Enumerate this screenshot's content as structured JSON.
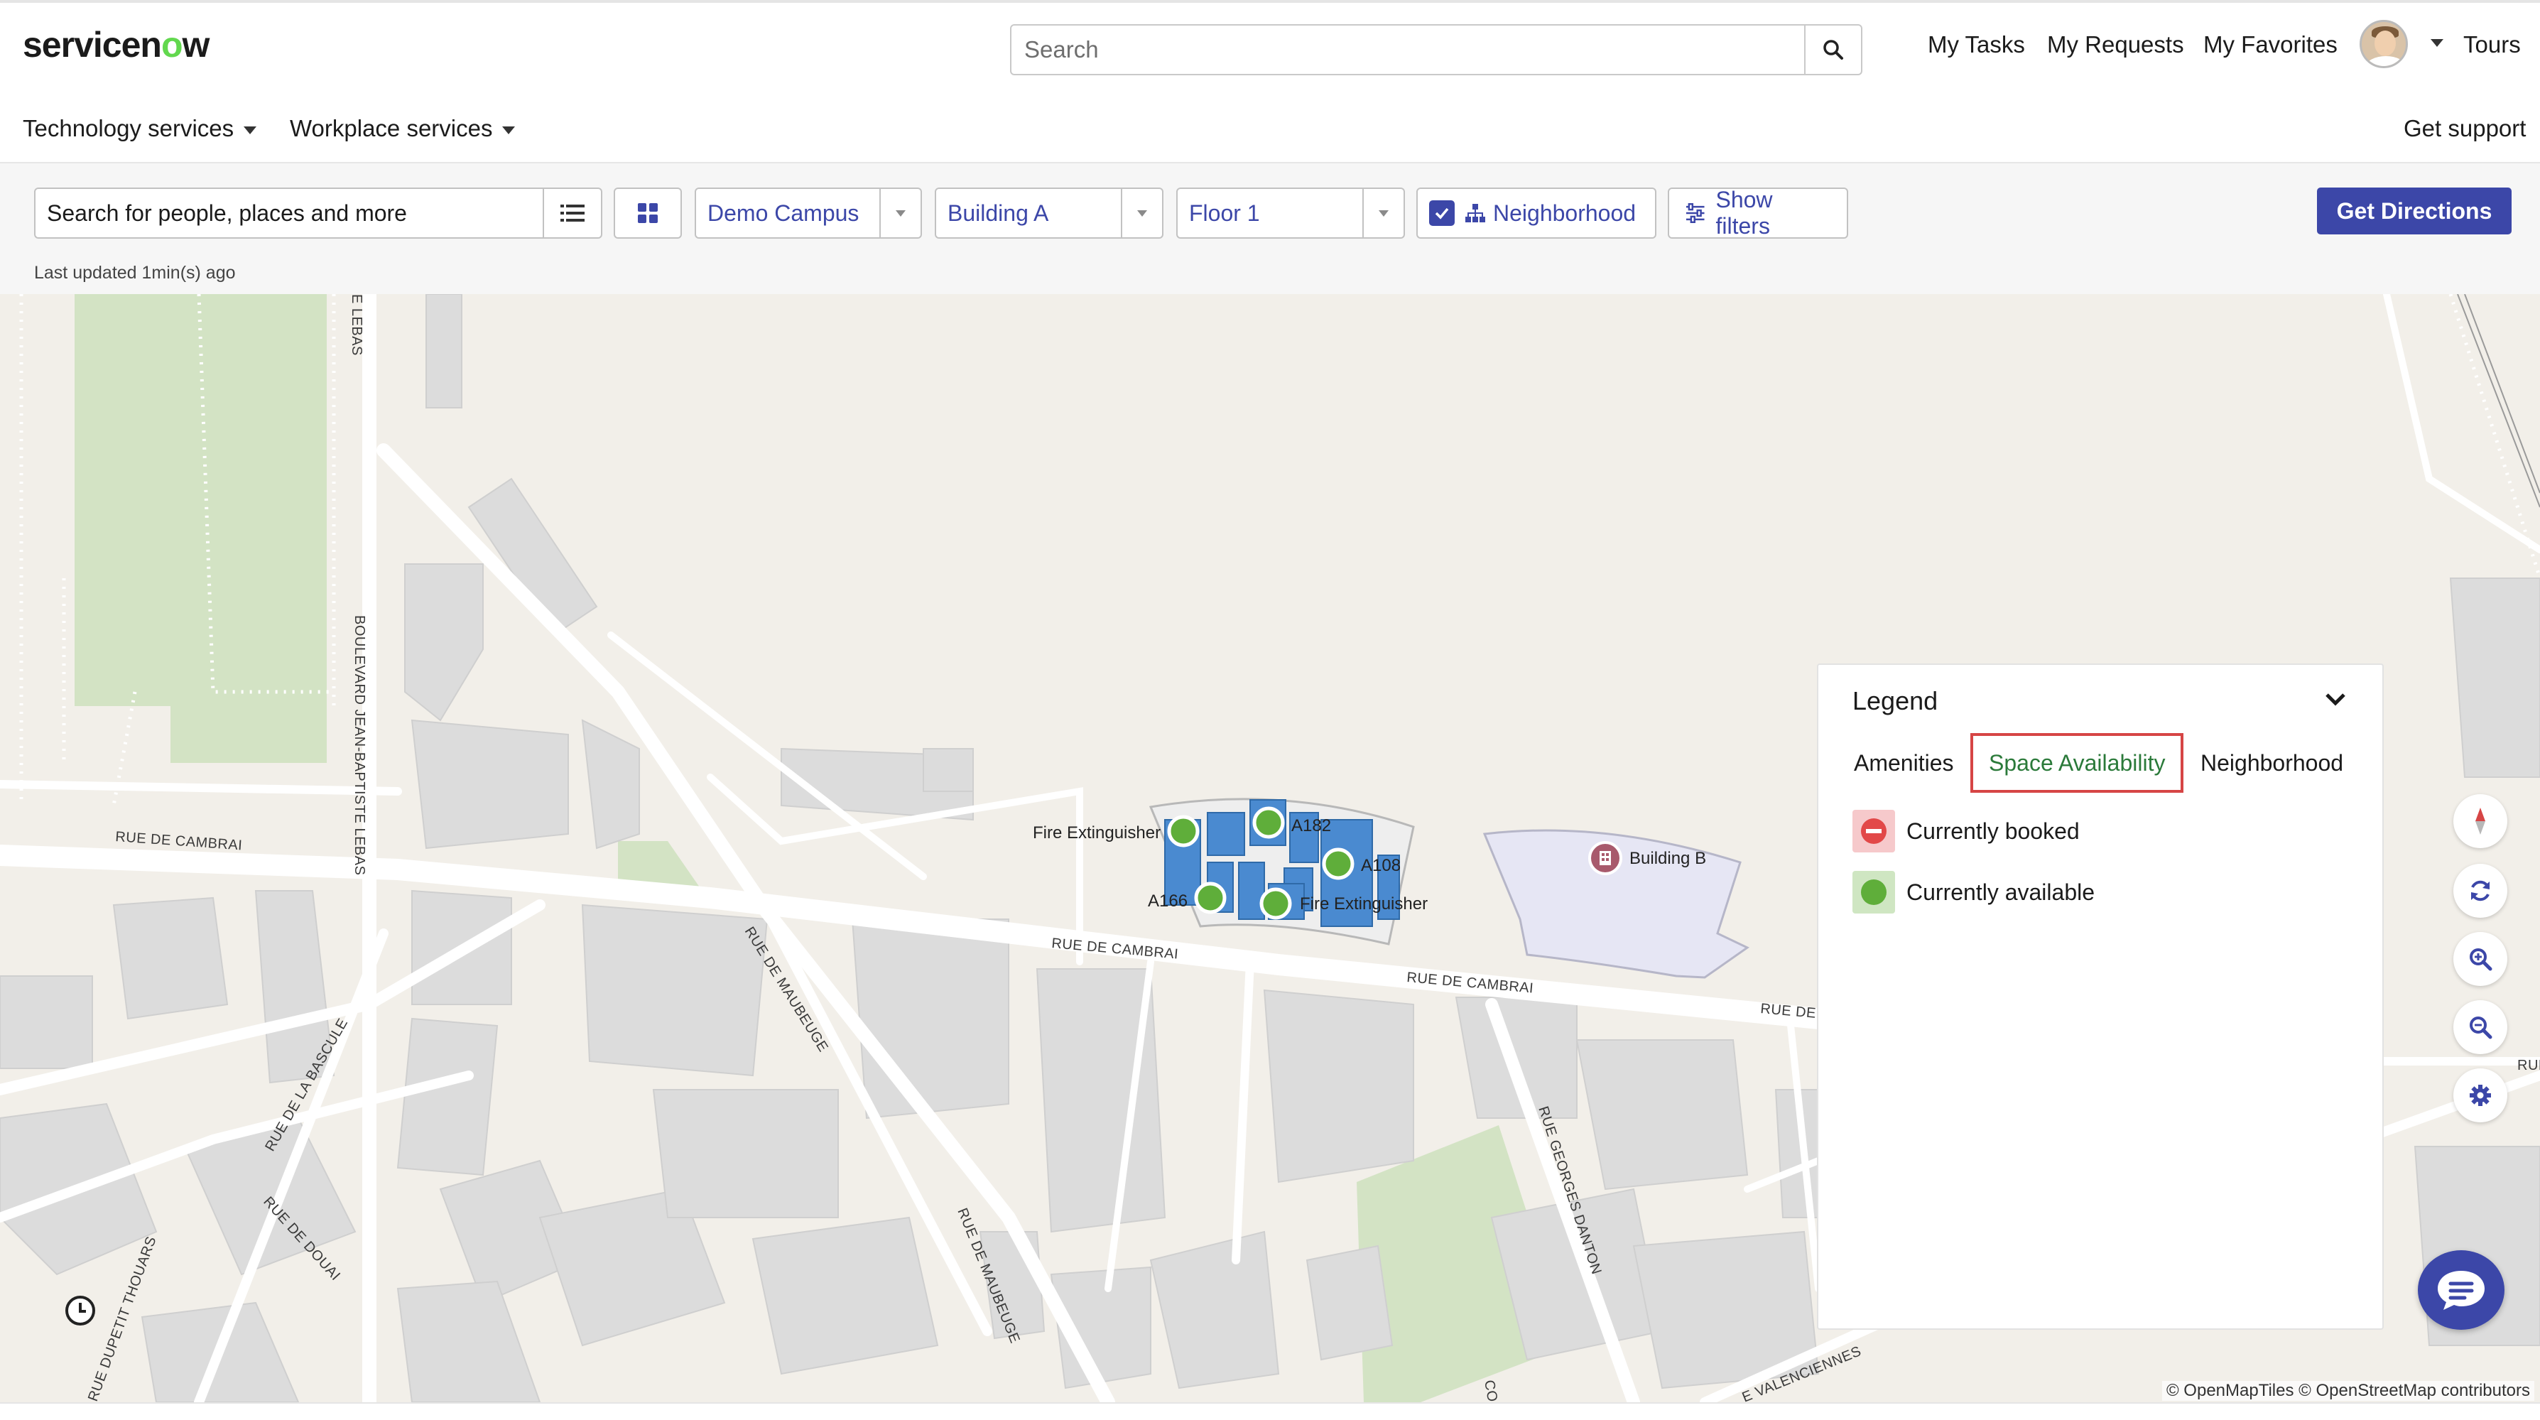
{
  "header": {
    "logo_text": "servicen",
    "logo_o": "o",
    "logo_tail": "w",
    "search_placeholder": "Search",
    "nav": [
      "My Tasks",
      "My Requests",
      "My Favorites",
      "Tours"
    ],
    "subnav": [
      "Technology services",
      "Workplace services"
    ],
    "get_support": "Get support"
  },
  "toolbar": {
    "search_placeholder": "Search for people, places and more",
    "campus": "Demo Campus",
    "building": "Building A",
    "floor": "Floor 1",
    "neighborhood_label": "Neighborhood",
    "neighborhood_checked": true,
    "show_filters": "Show filters",
    "get_directions": "Get Directions",
    "last_updated": "Last updated 1min(s) ago"
  },
  "map": {
    "streets": {
      "lebas_top": "E LEBAS",
      "boulevard": "BOULEVARD JEAN-BAPTISTE LEBAS",
      "cambrai_left": "RUE DE CAMBRAI",
      "cambrai_mid": "RUE DE CAMBRAI",
      "cambrai_right": "RUE DE CAMBRAI",
      "cambrai_far": "RUE DE C",
      "maubeuge_top": "RUE DE MAUBEUGE",
      "maubeuge_bottom": "RUE DE MAUBEUGE",
      "bascule": "RUE DE LA BASCULE",
      "douai": "RUE DE DOUAI",
      "thouars": "RUE DUPETIT THOUARS",
      "danton": "RUE GEORGES DANTON",
      "valenciennes": "E VALENCIENNES",
      "co": "CO",
      "rue_edge": "RUE"
    },
    "labels": {
      "fire1": "Fire Extinguisher",
      "fire2": "Fire Extinguisher",
      "a182": "A182",
      "a108": "A108",
      "a166": "A166",
      "building_b": "Building B"
    },
    "attribution": "© OpenMapTiles © OpenStreetMap contributors"
  },
  "legend": {
    "title": "Legend",
    "tabs": [
      "Amenities",
      "Space Availability",
      "Neighborhood"
    ],
    "active_tab": "Space Availability",
    "items": [
      "Currently booked",
      "Currently available"
    ]
  },
  "colors": {
    "primary": "#3c47a8",
    "available": "#5fae3a",
    "booked": "#e24848",
    "room_blue": "#4a8ad0",
    "active_tab_border": "#d64545"
  },
  "icons": [
    "search-icon",
    "list-icon",
    "grid-icon",
    "checkbox-icon",
    "hierarchy-icon",
    "sliders-icon",
    "chevron-down-icon",
    "compass-icon",
    "refresh-icon",
    "zoom-in-icon",
    "zoom-out-icon",
    "gear-icon",
    "chat-icon",
    "clock-icon"
  ]
}
